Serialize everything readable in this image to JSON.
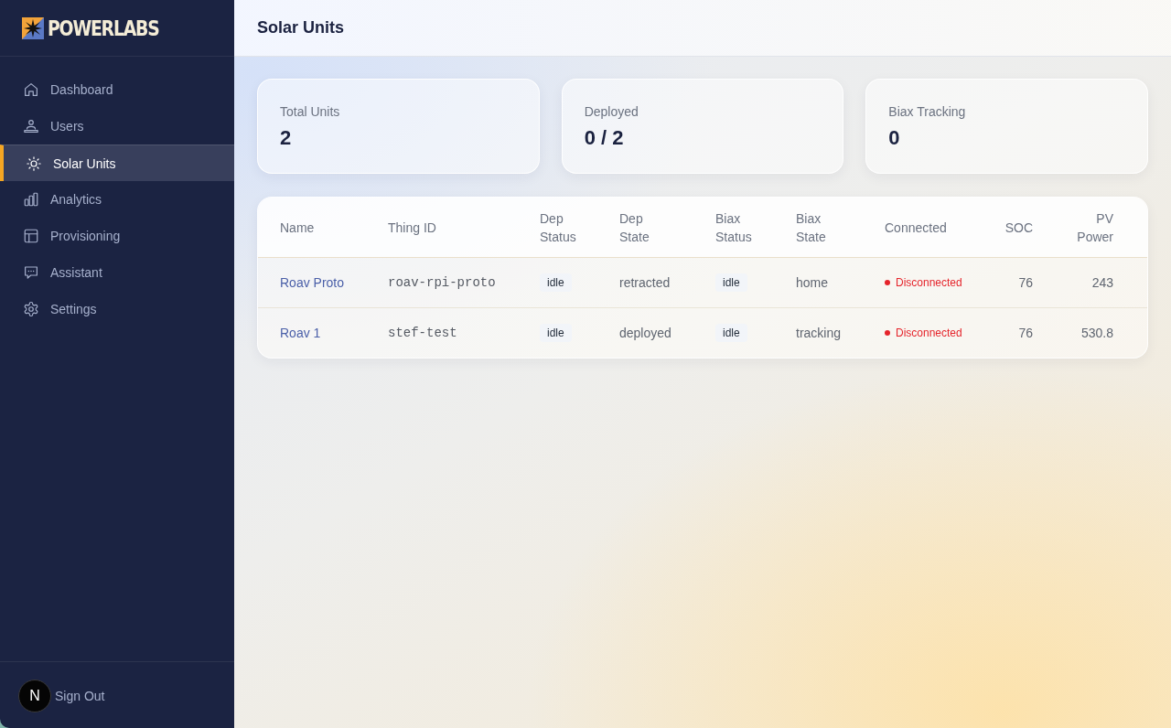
{
  "sidebar": {
    "brand": "POWERLABS",
    "items": [
      {
        "label": "Dashboard",
        "selected": false
      },
      {
        "label": "Users",
        "selected": false
      },
      {
        "label": "Solar Units",
        "selected": true
      },
      {
        "label": "Analytics",
        "selected": false
      },
      {
        "label": "Provisioning",
        "selected": false
      },
      {
        "label": "Assistant",
        "selected": false
      },
      {
        "label": "Settings",
        "selected": false
      }
    ],
    "footer": {
      "badge": "N",
      "sign_out": "Sign Out"
    }
  },
  "header": {
    "title": "Solar Units"
  },
  "stats": [
    {
      "label": "Total Units",
      "value": "2"
    },
    {
      "label": "Deployed",
      "value": "0 / 2"
    },
    {
      "label": "Biax Tracking",
      "value": "0"
    }
  ],
  "table": {
    "columns": [
      "Name",
      "Thing ID",
      "Dep Status",
      "Dep State",
      "Biax Status",
      "Biax State",
      "Connected",
      "SOC",
      "PV Power"
    ],
    "rows": [
      {
        "name": "Roav Proto",
        "thing_id": "roav-rpi-proto",
        "dep_status": "idle",
        "dep_state": "retracted",
        "biax_status": "idle",
        "biax_state": "home",
        "connection": {
          "label": "Disconnected",
          "connected": false
        },
        "soc": "76",
        "pv_power": "243"
      },
      {
        "name": "Roav 1",
        "thing_id": "stef-test",
        "dep_status": "idle",
        "dep_state": "deployed",
        "biax_status": "idle",
        "biax_state": "tracking",
        "connection": {
          "label": "Disconnected",
          "connected": false
        },
        "soc": "76",
        "pv_power": "530.8"
      }
    ]
  }
}
